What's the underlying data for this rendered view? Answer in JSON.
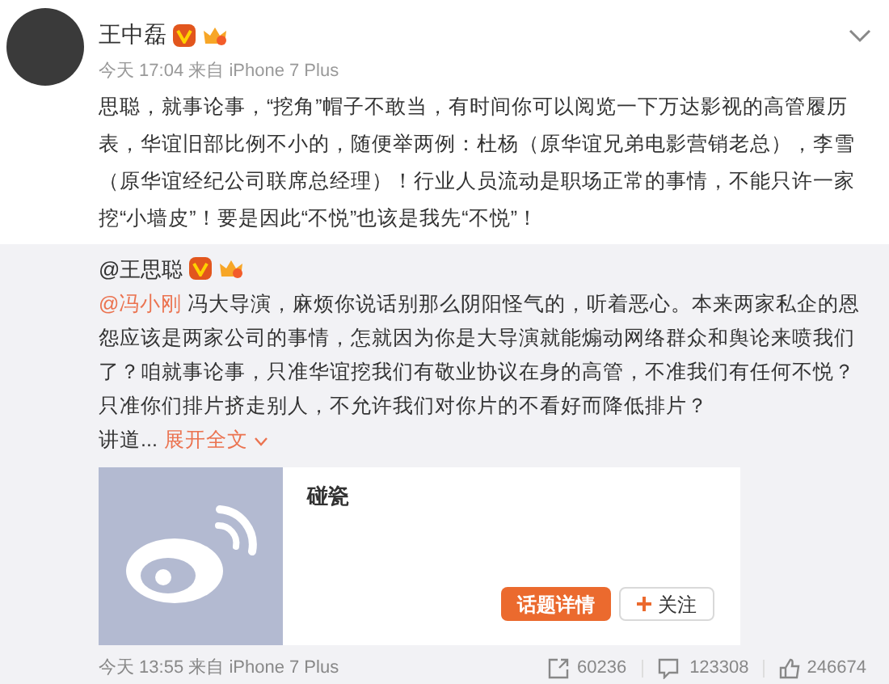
{
  "post": {
    "author": "王中磊",
    "verified": true,
    "time": "今天 17:04 来自 iPhone 7 Plus",
    "text": "思聪，就事论事，“挖角”帽子不敢当，有时间你可以阅览一下万达影视的高管履历表，华谊旧部比例不小的，随便举两例：杜杨（原华谊兄弟电影营销老总），李雪（原华谊经纪公司联席总经理）！行业人员流动是职场正常的事情，不能只许一家挖“小墙皮”！要是因此“不悦”也该是我先“不悦”！"
  },
  "repost": {
    "author": "@王思聪",
    "verified": true,
    "mention": "@冯小刚",
    "text": "冯大导演，麻烦你说话别那么阴阳怪气的，听着恶心。本来两家私企的恩怨应该是两家公司的事情，怎就因为你是大导演就能煽动网络群众和舆论来喷我们了？咱就事论事，只准华谊挖我们有敬业协议在身的高管，不准我们有任何不悦？只准你们排片挤走别人，不允许我们对你片的不看好而降低排片？",
    "tail": "讲道...",
    "expand": "展开全文",
    "card": {
      "title": "碰瓷",
      "primary_button": "话题详情",
      "follow_button": "关注"
    },
    "time": "今天 13:55 来自 iPhone 7 Plus",
    "reposts": "60236",
    "comments": "123308",
    "likes": "246674"
  }
}
